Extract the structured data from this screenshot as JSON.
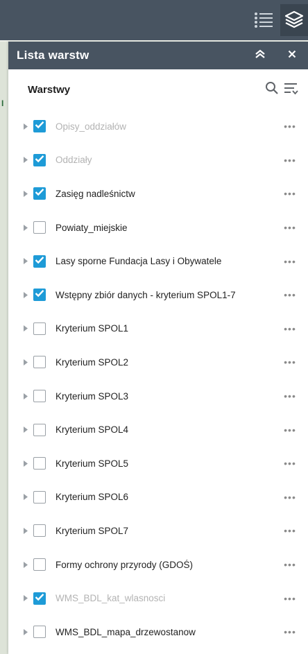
{
  "panel": {
    "title": "Lista warstw",
    "section_title": "Warstwy",
    "more_symbol": "•••"
  },
  "colors": {
    "header_bg": "#485461",
    "checkbox_checked": "#1e9bd7",
    "label_dim": "#b3b3b3"
  },
  "layers": [
    {
      "label": "Opisy_oddziałów",
      "checked": true,
      "dim": true
    },
    {
      "label": "Oddziały",
      "checked": true,
      "dim": true
    },
    {
      "label": "Zasięg nadleśnictw",
      "checked": true,
      "dim": false
    },
    {
      "label": "Powiaty_miejskie",
      "checked": false,
      "dim": false
    },
    {
      "label": "Lasy sporne Fundacja Lasy i Obywatele",
      "checked": true,
      "dim": false
    },
    {
      "label": "Wstępny zbiór danych - kryterium SPOL1-7",
      "checked": true,
      "dim": false
    },
    {
      "label": "Kryterium SPOL1",
      "checked": false,
      "dim": false
    },
    {
      "label": "Kryterium SPOL2",
      "checked": false,
      "dim": false
    },
    {
      "label": "Kryterium SPOL3",
      "checked": false,
      "dim": false
    },
    {
      "label": "Kryterium SPOL4",
      "checked": false,
      "dim": false
    },
    {
      "label": "Kryterium SPOL5",
      "checked": false,
      "dim": false
    },
    {
      "label": "Kryterium SPOL6",
      "checked": false,
      "dim": false
    },
    {
      "label": "Kryterium SPOL7",
      "checked": false,
      "dim": false
    },
    {
      "label": "Formy ochrony przyrody (GDOŚ)",
      "checked": false,
      "dim": false
    },
    {
      "label": "WMS_BDL_kat_wlasnosci",
      "checked": true,
      "dim": true
    },
    {
      "label": "WMS_BDL_mapa_drzewostanow",
      "checked": false,
      "dim": false
    }
  ],
  "icons": {
    "toolbar_list": "list-icon",
    "toolbar_layers": "layers-icon",
    "collapse": "double-chevron-up-icon",
    "close": "close-icon",
    "search": "search-icon",
    "filter": "filter-list-icon",
    "expander": "caret-right-icon",
    "checkmark": "check-icon",
    "more": "more-dots-icon"
  }
}
